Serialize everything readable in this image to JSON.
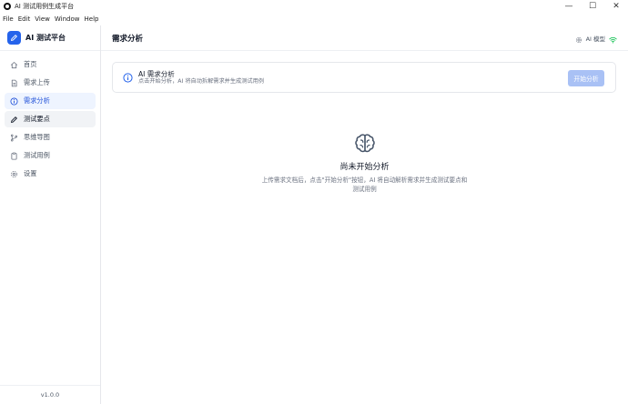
{
  "window": {
    "title": "AI 测试用例生成平台",
    "controls": {
      "minimize": "—",
      "maximize": "☐",
      "close": "✕"
    }
  },
  "menubar": [
    "File",
    "Edit",
    "View",
    "Window",
    "Help"
  ],
  "sidebar": {
    "brand": "AI 测试平台",
    "items": [
      {
        "label": "首页",
        "icon": "home-icon"
      },
      {
        "label": "需求上传",
        "icon": "file-icon"
      },
      {
        "label": "需求分析",
        "icon": "info-icon",
        "state": "active"
      },
      {
        "label": "测试要点",
        "icon": "pencil-icon",
        "state": "hover"
      },
      {
        "label": "思维导图",
        "icon": "branch-icon"
      },
      {
        "label": "测试用例",
        "icon": "clipboard-icon"
      },
      {
        "label": "设置",
        "icon": "gear-icon"
      }
    ],
    "version": "v1.0.0"
  },
  "header": {
    "title": "需求分析",
    "model_label": "AI 模型",
    "model_status_color": "#22c55e"
  },
  "card": {
    "title": "AI 需求分析",
    "description": "点击开始分析，AI 将自动拆解需求并生成测试用例",
    "button_label": "开始分析"
  },
  "empty_state": {
    "icon": "brain-icon",
    "title": "尚未开始分析",
    "description": "上传需求文档后，点击\"开始分析\"按钮，AI 将自动解析需求并生成测试要点和测试用例"
  },
  "colors": {
    "accent": "#2563eb",
    "button_disabled": "#a9c1f5",
    "active_bg": "#eef4ff"
  }
}
